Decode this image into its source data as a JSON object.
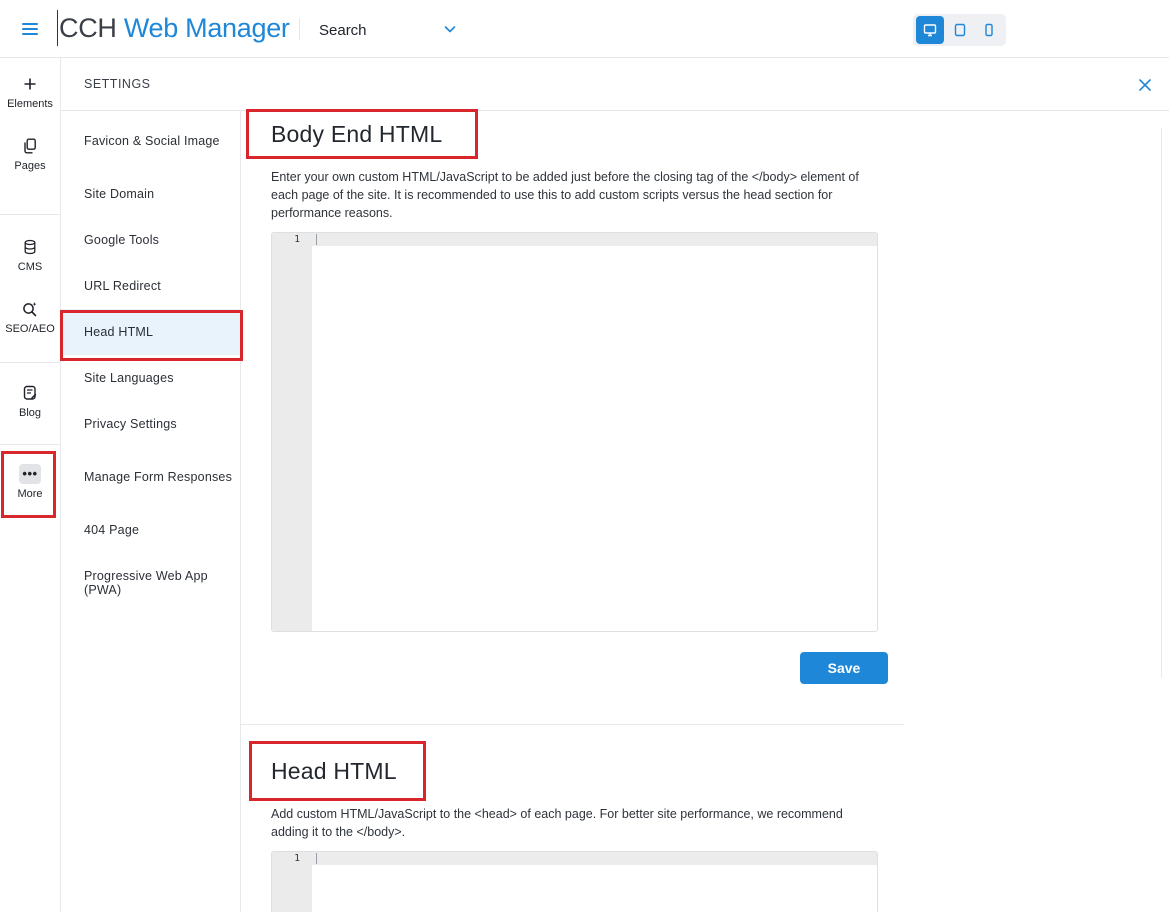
{
  "app": {
    "logo_part1": "CCH",
    "logo_part2": "Web Manager",
    "search_label": "Search"
  },
  "device_buttons": [
    {
      "name": "desktop",
      "icon": "desktop-icon",
      "active": true
    },
    {
      "name": "tablet",
      "icon": "tablet-icon",
      "active": false
    },
    {
      "name": "mobile",
      "icon": "mobile-icon",
      "active": false
    }
  ],
  "rail": {
    "elements": "Elements",
    "pages": "Pages",
    "cms": "CMS",
    "seo": "SEO/AEO",
    "blog": "Blog",
    "more_icon": "•••",
    "more": "More"
  },
  "settings": {
    "title": "SETTINGS",
    "items": [
      "Favicon & Social Image",
      "Site Domain",
      "Google Tools",
      "URL Redirect",
      "Head HTML",
      "Site Languages",
      "Privacy Settings",
      "Manage Form Responses",
      "404 Page",
      "Progressive Web App (PWA)"
    ],
    "active": "Head HTML"
  },
  "body_end": {
    "title": "Body End HTML",
    "description": "Enter your own custom HTML/JavaScript to be added just before the closing tag of the </body> element of each page of the site. It is recommended to use this to add custom scripts versus the head section for performance reasons.",
    "line_number": "1",
    "save_label": "Save"
  },
  "head_html": {
    "title": "Head HTML",
    "description": "Add custom HTML/JavaScript to the <head> of each page. For better site performance, we recommend adding it to the </body>.",
    "line_number": "1"
  },
  "colors": {
    "accent": "#1e87d8",
    "highlight": "#d9262c",
    "active_nav_bg": "#e8f3fc"
  }
}
